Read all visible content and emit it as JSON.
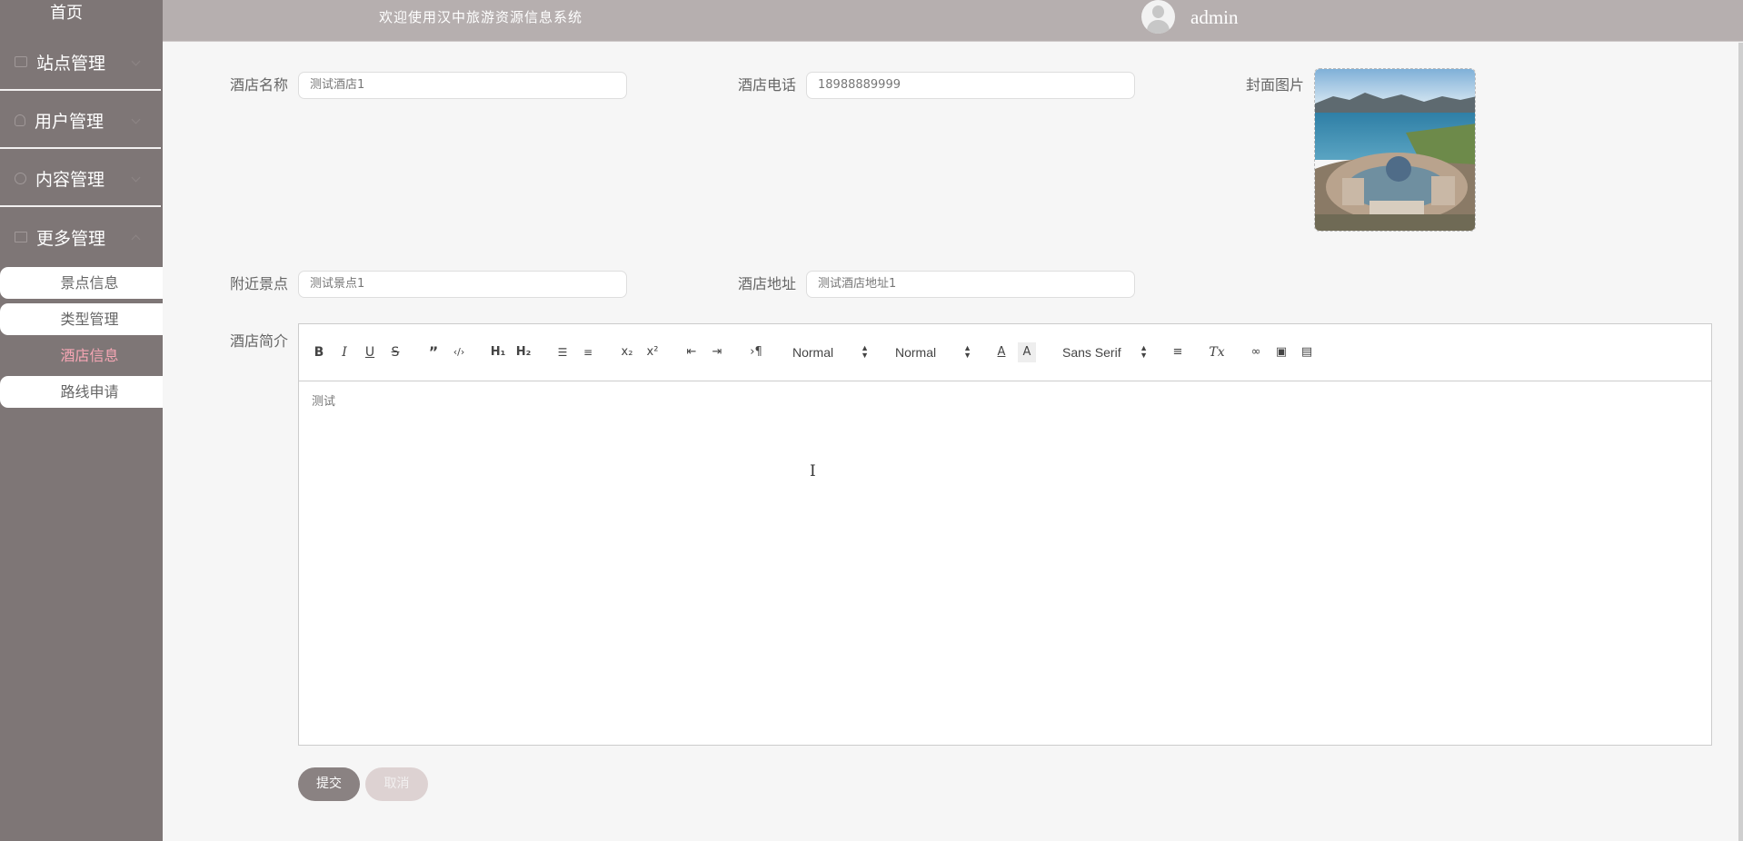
{
  "sidebar": {
    "home": "首页",
    "groups": [
      {
        "label": "站点管理",
        "icon": "monitor-icon"
      },
      {
        "label": "用户管理",
        "icon": "user-icon"
      },
      {
        "label": "内容管理",
        "icon": "chat-icon"
      },
      {
        "label": "更多管理",
        "icon": "copy-icon"
      }
    ],
    "sub_items": [
      {
        "label": "景点信息"
      },
      {
        "label": "类型管理"
      },
      {
        "label": "酒店信息",
        "active": true
      },
      {
        "label": "路线申请"
      }
    ]
  },
  "header": {
    "welcome": "欢迎使用汉中旅游资源信息系统",
    "username": "admin",
    "avatar_icon": "avatar-icon"
  },
  "form": {
    "hotel_name_label": "酒店名称",
    "hotel_name_value": "测试酒店1",
    "hotel_phone_label": "酒店电话",
    "hotel_phone_value": "18988889999",
    "cover_label": "封面图片",
    "nearby_label": "附近景点",
    "nearby_value": "测试景点1",
    "address_label": "酒店地址",
    "address_value": "测试酒店地址1",
    "intro_label": "酒店简介",
    "intro_value": "测试",
    "submit_label": "提交",
    "cancel_label": "取消"
  },
  "toolbar": {
    "header_picker": "Normal",
    "size_picker": "Normal",
    "font_picker": "Sans Serif"
  },
  "colors": {
    "sidebar_bg": "#7e7676",
    "header_bg": "#b6afaf",
    "active_item": "#f6a6b4",
    "submit_bg": "#8a8282",
    "cancel_bg": "#ddd2d2"
  }
}
